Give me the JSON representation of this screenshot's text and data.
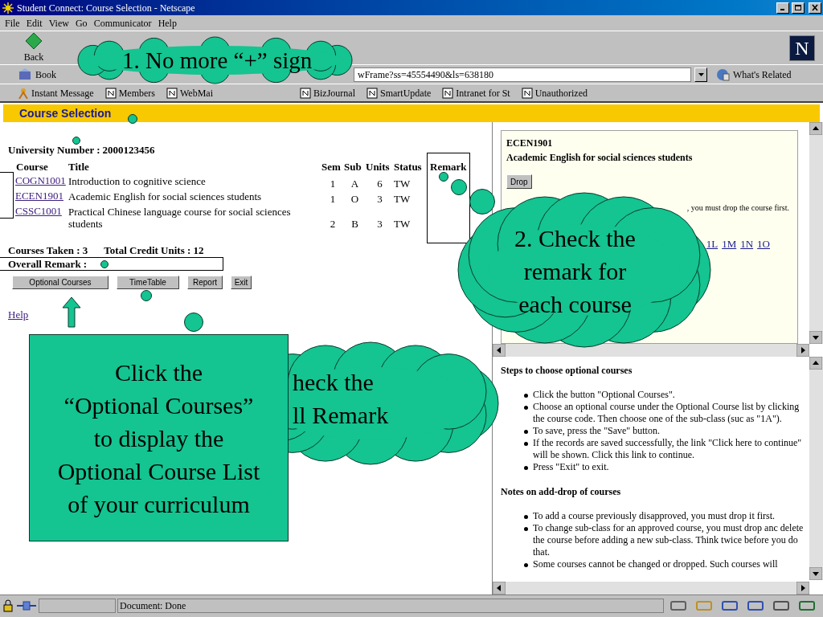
{
  "window": {
    "title": "Student Connect: Course Selection - Netscape"
  },
  "menu": [
    "File",
    "Edit",
    "View",
    "Go",
    "Communicator",
    "Help"
  ],
  "toolbar": {
    "back_label": "Back",
    "logo_letter": "N"
  },
  "location_bar": {
    "bookmarks_label": "Book",
    "url": "wFrame?ss=45554490&ls=638180",
    "related": "What's Related"
  },
  "personal_bar": [
    {
      "label": "Instant Message",
      "kind": "person"
    },
    {
      "label": "Members",
      "kind": "page"
    },
    {
      "label": "WebMai",
      "kind": "page"
    },
    {
      "label": "BizJournal",
      "kind": "page"
    },
    {
      "label": "SmartUpdate",
      "kind": "page"
    },
    {
      "label": "Intranet for St",
      "kind": "page"
    },
    {
      "label": "Unauthorized",
      "kind": "page"
    }
  ],
  "page": {
    "heading": "Course Selection",
    "university_number_label": "University Number :",
    "university_number": "2000123456",
    "columns": [
      "Course",
      "Title",
      "Sem",
      "Sub",
      "Units",
      "Status",
      "Remark"
    ],
    "rows": [
      {
        "code": "COGN1001",
        "title": "Introduction to cognitive science",
        "sem": "1",
        "sub": "A",
        "units": "6",
        "status": "TW"
      },
      {
        "code": "ECEN1901",
        "title": "Academic English for social sciences students",
        "sem": "1",
        "sub": "O",
        "units": "3",
        "status": "TW"
      },
      {
        "code": "CSSC1001",
        "title": "Practical Chinese language course for social sciences students",
        "sem": "2",
        "sub": "B",
        "units": "3",
        "status": "TW"
      }
    ],
    "courses_taken": "Courses Taken : 3",
    "total_credit": "Total Credit Units : 12",
    "overall_remark": "Overall Remark :",
    "buttons": [
      "Optional Courses",
      "TimeTable",
      "Report",
      "Exit"
    ],
    "help_link": "Help"
  },
  "detail_frame": {
    "code": "ECEN1901",
    "title": "Academic English for social sciences students",
    "button": "Drop",
    "note": ", you must drop the course first.",
    "subclass_links": [
      "1L",
      "1M",
      "1N",
      "1O"
    ]
  },
  "help_frame": {
    "sections": [
      {
        "heading": "Steps to choose optional courses",
        "items": [
          "Click the button \"Optional Courses\".",
          "Choose an optional course under the Optional Course list by clicking the course code. Then choose one of the sub-class (suc as \"1A\").",
          "To save, press the \"Save\" button.",
          "If the records are saved successfully, the link \"Click here to continue\" will be shown. Click this link to continue.",
          "Press \"Exit\" to exit."
        ]
      },
      {
        "heading": "Notes on add-drop of courses",
        "items": [
          "To add a course previously disapproved, you must drop it first.",
          "To change sub-class for an approved course, you must drop anc delete the course before adding a new sub-class. Think twice before you do that.",
          "Some courses cannot be changed or dropped. Such courses will"
        ]
      }
    ]
  },
  "status_bar": {
    "text": "Document: Done"
  },
  "callouts": [
    {
      "kind": "cloud",
      "lines": [
        "1. No more “+” sign"
      ]
    },
    {
      "kind": "cloud",
      "lines": [
        "2. Check the",
        "remark for",
        "each course"
      ]
    },
    {
      "kind": "box",
      "lines": [
        "Click the",
        "“Optional Courses”",
        "to display the",
        "Optional Course List",
        "of your curriculum"
      ]
    },
    {
      "kind": "cloud",
      "lines": [
        "heck the",
        "ll Remark"
      ]
    }
  ]
}
